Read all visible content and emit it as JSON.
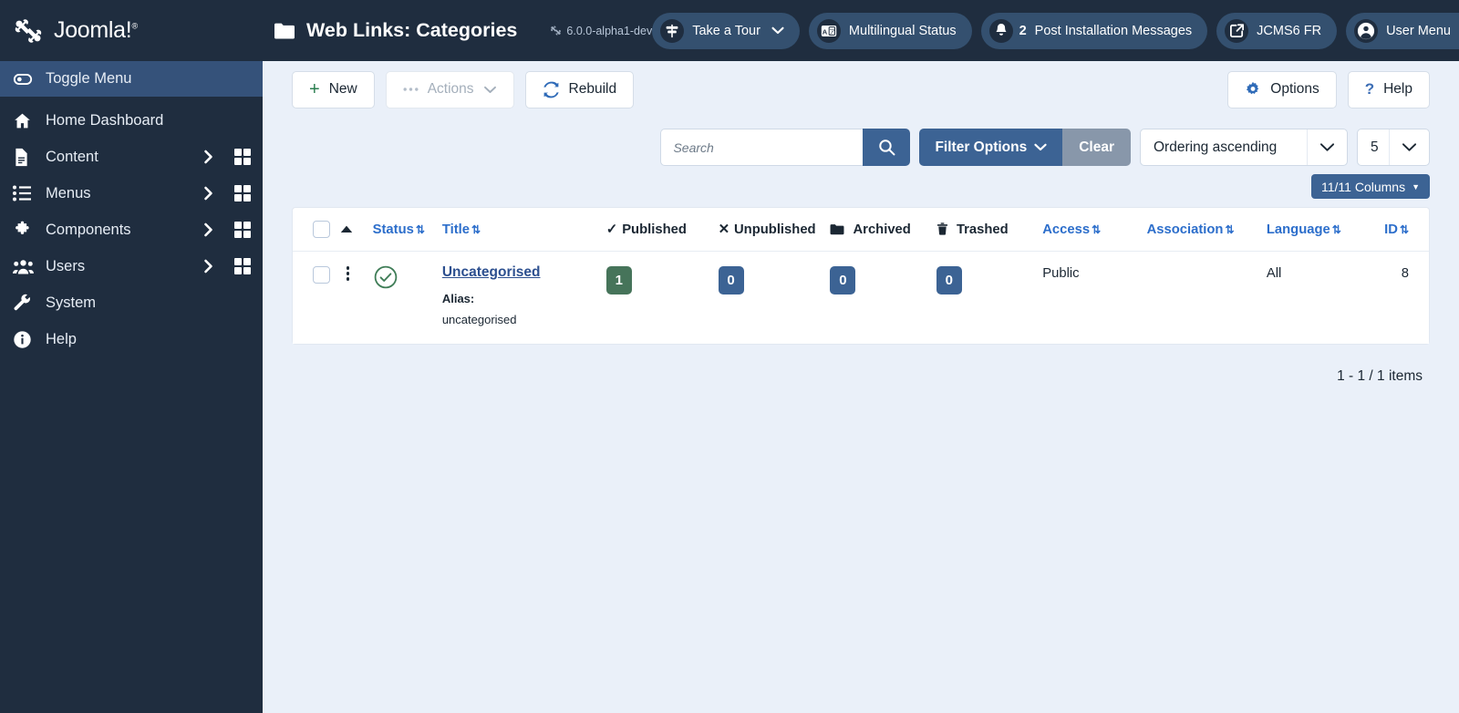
{
  "brand": {
    "name": "Joomla!",
    "trademark": "®",
    "logo_icon": "joomla-logo-icon"
  },
  "sidebar": {
    "items": [
      {
        "label": "Toggle Menu",
        "icon": "toggle-switch-icon",
        "active": true,
        "has_caret": false,
        "has_grid": false
      },
      {
        "label": "Home Dashboard",
        "icon": "home-icon",
        "active": false,
        "has_caret": false,
        "has_grid": false
      },
      {
        "label": "Content",
        "icon": "document-icon",
        "active": false,
        "has_caret": true,
        "has_grid": true
      },
      {
        "label": "Menus",
        "icon": "list-icon",
        "active": false,
        "has_caret": true,
        "has_grid": true
      },
      {
        "label": "Components",
        "icon": "puzzle-icon",
        "active": false,
        "has_caret": true,
        "has_grid": true
      },
      {
        "label": "Users",
        "icon": "users-icon",
        "active": false,
        "has_caret": true,
        "has_grid": true
      },
      {
        "label": "System",
        "icon": "wrench-icon",
        "active": false,
        "has_caret": false,
        "has_grid": false
      },
      {
        "label": "Help",
        "icon": "info-circle-icon",
        "active": false,
        "has_caret": false,
        "has_grid": false
      }
    ]
  },
  "header": {
    "title": "Web Links: Categories",
    "title_icon": "folder-icon",
    "version": "6.0.0-alpha1-dev",
    "version_icon": "joomla-mark-icon",
    "pills": [
      {
        "label": "Take a Tour",
        "icon": "signpost-icon",
        "chevron": true,
        "count": null
      },
      {
        "label": "Multilingual Status",
        "icon": "language-card-icon",
        "chevron": false,
        "count": null
      },
      {
        "label": "Post Installation Messages",
        "icon": "bell-icon",
        "chevron": false,
        "count": "2"
      },
      {
        "label": "JCMS6 FR",
        "icon": "external-link-icon",
        "chevron": false,
        "count": null
      },
      {
        "label": "User Menu",
        "icon": "user-circle-icon",
        "chevron": true,
        "count": null
      }
    ]
  },
  "toolbar": {
    "new_label": "New",
    "new_icon": "plus-icon",
    "actions_label": "Actions",
    "actions_icon": "ellipsis-icon",
    "actions_chevron_icon": "chevron-down-icon",
    "actions_disabled": true,
    "rebuild_label": "Rebuild",
    "rebuild_icon": "refresh-icon",
    "options_label": "Options",
    "options_icon": "gear-icon",
    "help_label": "Help",
    "help_icon": "question-mark-icon"
  },
  "filters": {
    "search_placeholder": "Search",
    "search_value": "",
    "search_icon": "search-icon",
    "filter_options_label": "Filter Options",
    "filter_options_icon": "chevron-down-icon",
    "clear_label": "Clear",
    "ordering_value": "Ordering ascending",
    "limit_value": "5",
    "columns_label": "11/11 Columns",
    "columns_caret_icon": "caret-down-icon"
  },
  "table": {
    "columns": [
      {
        "key": "checkbox",
        "label": "",
        "sortable": false,
        "icon": "checkbox-icon",
        "accent": false
      },
      {
        "key": "ordering",
        "label": "",
        "sortable": false,
        "icon": "sort-asc-icon",
        "accent": true
      },
      {
        "key": "status",
        "label": "Status",
        "sortable": true,
        "icon": null,
        "accent": true
      },
      {
        "key": "title",
        "label": "Title",
        "sortable": true,
        "icon": null,
        "accent": true
      },
      {
        "key": "published",
        "label": "Published",
        "sortable": false,
        "icon": "check-icon",
        "accent": false
      },
      {
        "key": "unpublished",
        "label": "Unpublished",
        "sortable": false,
        "icon": "x-icon",
        "accent": false
      },
      {
        "key": "archived",
        "label": "Archived",
        "sortable": false,
        "icon": "archive-icon",
        "accent": false
      },
      {
        "key": "trashed",
        "label": "Trashed",
        "sortable": false,
        "icon": "trash-icon",
        "accent": false
      },
      {
        "key": "access",
        "label": "Access",
        "sortable": true,
        "icon": null,
        "accent": true
      },
      {
        "key": "association",
        "label": "Association",
        "sortable": true,
        "icon": null,
        "accent": true
      },
      {
        "key": "language",
        "label": "Language",
        "sortable": true,
        "icon": null,
        "accent": true
      },
      {
        "key": "id",
        "label": "ID",
        "sortable": true,
        "icon": null,
        "accent": true
      }
    ],
    "rows": [
      {
        "status_icon": "check-circle-icon",
        "status_color": "#3f7d57",
        "actions_icon": "vertical-dots-icon",
        "title": "Uncategorised",
        "alias_label": "Alias:",
        "alias_value": "uncategorised",
        "published": "1",
        "published_badge_color": "#46745a",
        "unpublished": "0",
        "archived": "0",
        "trashed": "0",
        "badge_color": "#3c6394",
        "access": "Public",
        "association": "",
        "language": "All",
        "id": "8"
      }
    ],
    "counter": "1 - 1 / 1 items"
  },
  "colors": {
    "sidebar_bg": "#1f2d3f",
    "sidebar_active": "#35527a",
    "page_bg": "#eaf0f9",
    "accent_blue": "#3c6394",
    "link_blue": "#2c6ecb",
    "badge_green": "#46745a",
    "clear_gray": "#8897aa"
  }
}
